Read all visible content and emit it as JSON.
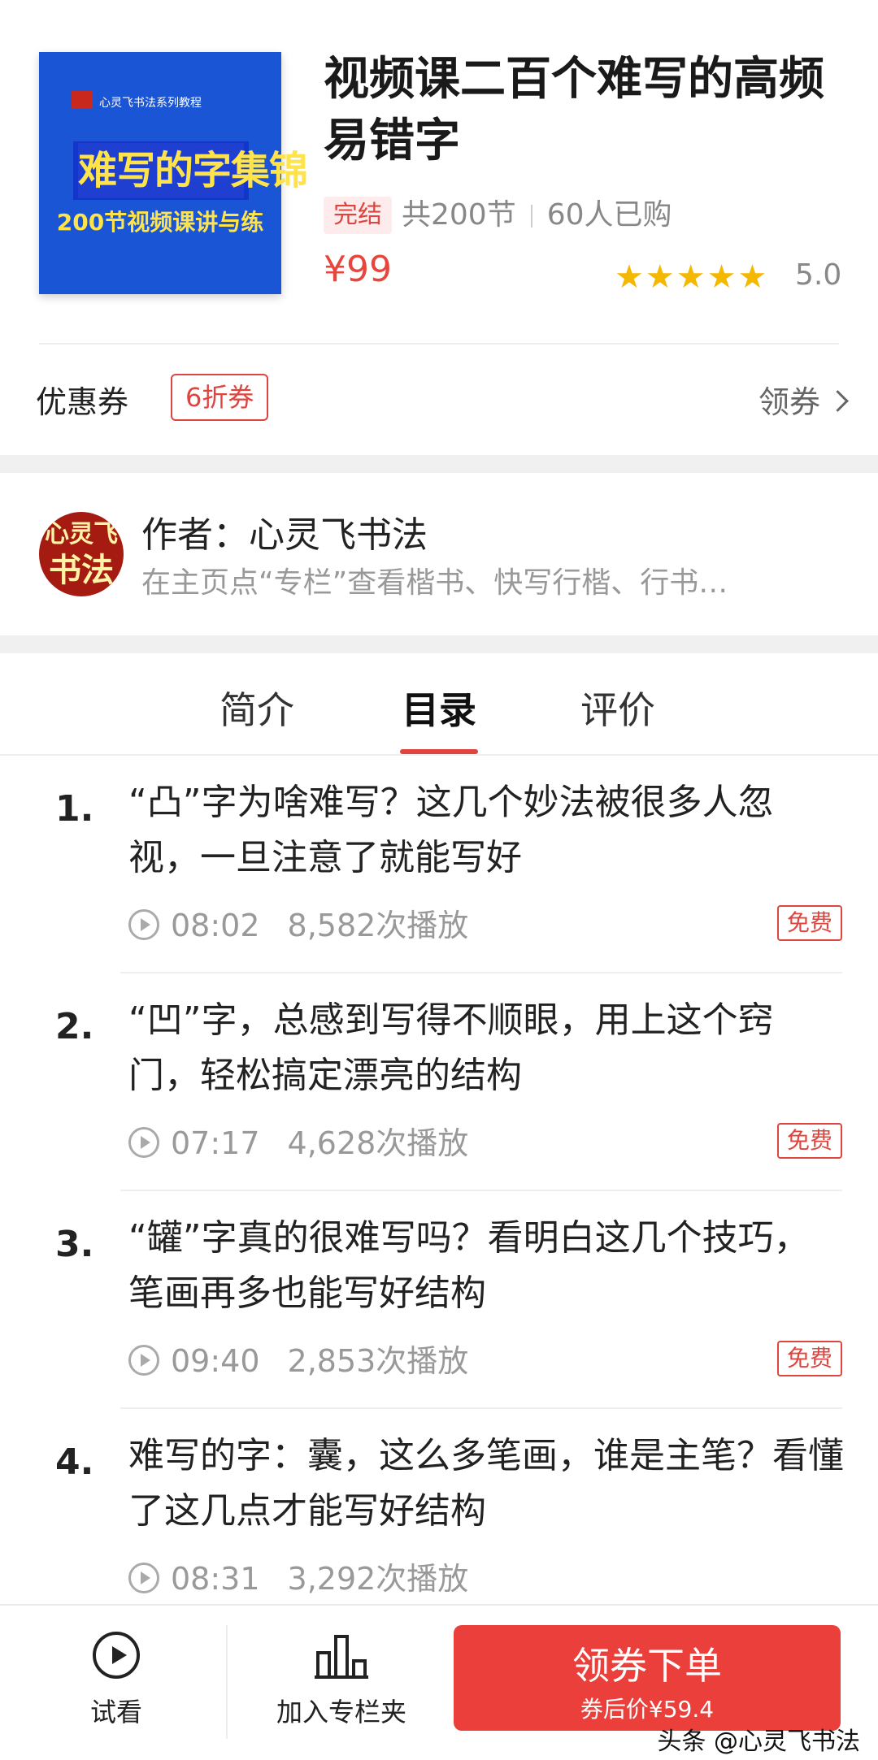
{
  "course": {
    "cover": {
      "series": "心灵飞书法系列教程",
      "title": "难写的字集锦",
      "subtitle": "200节视频课讲与练"
    },
    "title": "视频课二百个难写的高频易错字",
    "status_tag": "完结",
    "lessons": "共200节",
    "buyers": "60人已购",
    "price": "¥99",
    "stars": "★★★★★",
    "rating": "5.0"
  },
  "coupon": {
    "label": "优惠券",
    "tag": "6折券",
    "action": "领券"
  },
  "author": {
    "avatar_text_top": "心灵飞",
    "avatar_text_bottom": "书法",
    "name": "作者：心灵飞书法",
    "desc": "在主页点“专栏”查看楷书、快写行楷、行书…"
  },
  "tabs": [
    {
      "label": "简介"
    },
    {
      "label": "目录"
    },
    {
      "label": "评价"
    }
  ],
  "active_tab": "目录",
  "lessons": [
    {
      "num": "1.",
      "title": "“凸”字为啥难写？这几个妙法被很多人忽视，一旦注意了就能写好",
      "duration": "08:02",
      "plays": "8,582次播放",
      "badge": "免费"
    },
    {
      "num": "2.",
      "title": "“凹”字，总感到写得不顺眼，用上这个窍门，轻松搞定漂亮的结构",
      "duration": "07:17",
      "plays": "4,628次播放",
      "badge": "免费"
    },
    {
      "num": "3.",
      "title": "“罐”字真的很难写吗？看明白这几个技巧，笔画再多也能写好结构",
      "duration": "09:40",
      "plays": "2,853次播放",
      "badge": "免费"
    },
    {
      "num": "4.",
      "title": "难写的字：囊，这么多笔画，谁是主笔？看懂了这几点才能写好结构",
      "duration": "08:31",
      "plays": "3,292次播放",
      "badge": ""
    }
  ],
  "bottom_bar": {
    "try_label": "试看",
    "collect_label": "加入专栏夹",
    "buy_label": "领券下单",
    "buy_sub": "券后价¥59.4"
  },
  "watermark": "头条 @心灵飞书法",
  "colors": {
    "accent": "#ea3f3a",
    "star": "#f5b800",
    "cover_bg": "#1a55d6"
  }
}
